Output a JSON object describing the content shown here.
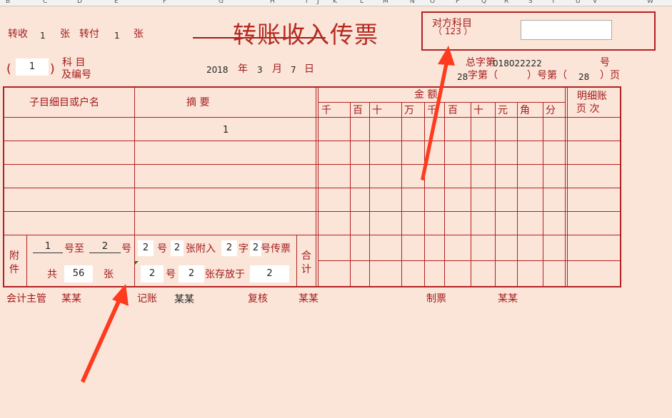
{
  "sheet": {
    "column_letters": [
      "B",
      "C",
      "D",
      "E",
      "F",
      "G",
      "H",
      "I",
      "J",
      "K",
      "L",
      "M",
      "N",
      "O",
      "P",
      "Q",
      "R",
      "S",
      "T",
      "U",
      "V",
      "W"
    ]
  },
  "header": {
    "zhuanshou_label": "转收",
    "zhuanshou_count": "1",
    "zhang1": "张",
    "zhuanfu_label": "转付",
    "zhuanfu_count": "1",
    "zhang2": "张",
    "title": "转账收入传票",
    "duifang_label": "对方科目",
    "duifang_value": "（ 123 ）",
    "subject_value": "1",
    "paren_open": "(",
    "paren_close": ")",
    "kemu_label": "科  目",
    "bianhao_label": "及编号",
    "date_year": "2018",
    "year_label": "年",
    "date_month": "3",
    "month_label": "月",
    "date_day": "7",
    "day_label": "日",
    "zongzi_label": "总字第",
    "zongzi_value": "018022222",
    "hao1": "号",
    "zi_prefix": "28",
    "zidi_label": "字第（",
    "hao_close": "）号第（",
    "page_value": "28",
    "ye_label": "）页"
  },
  "table": {
    "col_account": "子目细目或户名",
    "col_summary": "摘      要",
    "col_amount": "金        额",
    "col_ledger": "明细账",
    "col_ledger_sub": "页   次",
    "digit_headers": [
      "千",
      "百",
      "十",
      "万",
      "千",
      "百",
      "十",
      "元",
      "角",
      "分"
    ],
    "row1_summary": "1",
    "attachment_label_1": "附",
    "attachment_label_2": "件",
    "att_from": "1",
    "att_hao_zhi": "号至",
    "att_to": "2",
    "att_hao": "号",
    "att_total_label": "共",
    "att_total": "56",
    "att_zhang": "张",
    "mid_v1": "2",
    "mid_hao": "号",
    "mid_v2": "2",
    "mid_fu": "张附入",
    "mid_v3": "2",
    "mid_zi": "字",
    "mid_v4": "2",
    "mid_chuanpiao": "号传票",
    "mid_v5": "2",
    "mid_hao2": "号",
    "mid_v6": "2",
    "mid_cunfang": "张存放于",
    "mid_v7": "2",
    "heji_1": "合",
    "heji_2": "计"
  },
  "footer": {
    "kuaiji_label": "会计主管",
    "kuaiji_value": "某某",
    "jizhang_label": "记账",
    "jizhang_value": "某某",
    "fuhe_label": "复核",
    "fuhe_value": "某某",
    "zhipiao_label": "制票",
    "zhipiao_value": "某某"
  }
}
